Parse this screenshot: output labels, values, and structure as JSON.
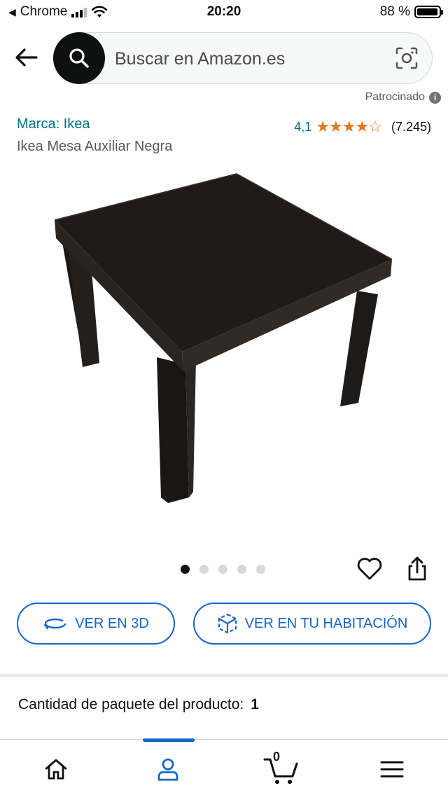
{
  "status_bar": {
    "back_app": "Chrome",
    "time": "20:20",
    "battery": "88 %"
  },
  "search": {
    "placeholder": "Buscar en Amazon.es"
  },
  "sponsored": {
    "label": "Patrocinado",
    "info_glyph": "i"
  },
  "product": {
    "brand": "Marca: Ikea",
    "title": "Ikea Mesa Auxiliar Negra",
    "rating_value": "4,1",
    "stars": "★★★★☆",
    "rating_count": "(7.245)",
    "image_dots": 5,
    "active_dot": 0
  },
  "actions": {
    "view_3d": "VER EN 3D",
    "view_room": "VER EN TU HABITACIÓN"
  },
  "quantity": {
    "label": "Cantidad de paquete del producto:",
    "value": "1"
  },
  "bottom_nav": {
    "cart_count": "0",
    "items": [
      "home-icon",
      "account-icon",
      "cart-icon",
      "menu-icon"
    ],
    "active": "account-icon"
  },
  "colors": {
    "link": "#007185",
    "accent_blue": "#1966c8",
    "star": "#de7921"
  }
}
